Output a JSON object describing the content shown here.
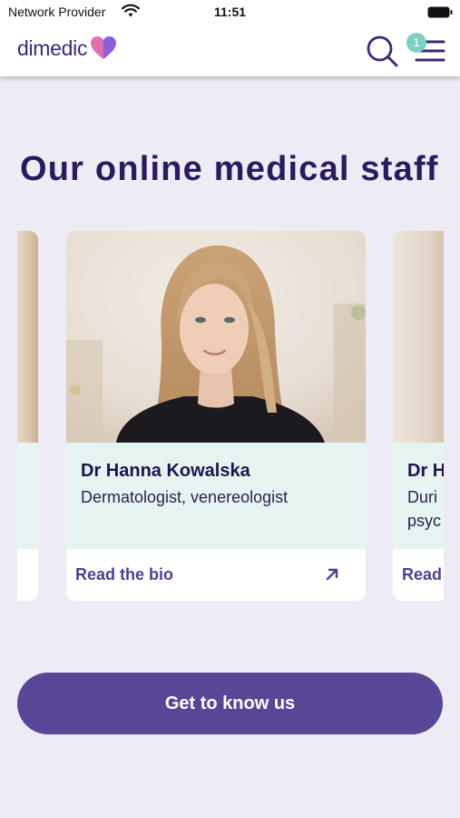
{
  "status_bar": {
    "carrier": "Network Provider",
    "time": "11:51",
    "wifi_icon": "wifi-icon",
    "battery_icon": "battery-icon"
  },
  "header": {
    "logo_text": "dimedic",
    "logo_icon": "heart-logo-icon",
    "search_icon": "search-icon",
    "menu_icon": "hamburger-menu-icon",
    "menu_badge_count": "1"
  },
  "section": {
    "title": "Our online medical staff"
  },
  "carousel": {
    "cards": [
      {
        "name": "Dr Hanna Kowalska",
        "role": "Dermatologist, venereologist",
        "link_label": "Read the bio",
        "link_icon": "arrow-up-right-icon"
      }
    ],
    "next_card_peek": {
      "name": "Dr H",
      "role_line1": "Duri",
      "role_line2": "psyc",
      "link_label": "Read"
    }
  },
  "cta": {
    "label": "Get to know us"
  },
  "colors": {
    "brand_purple": "#574796",
    "title_purple": "#2a1a5e",
    "info_mint": "#e6f4f1",
    "page_bg": "#edebf4",
    "badge_teal": "#7fcfc4"
  }
}
